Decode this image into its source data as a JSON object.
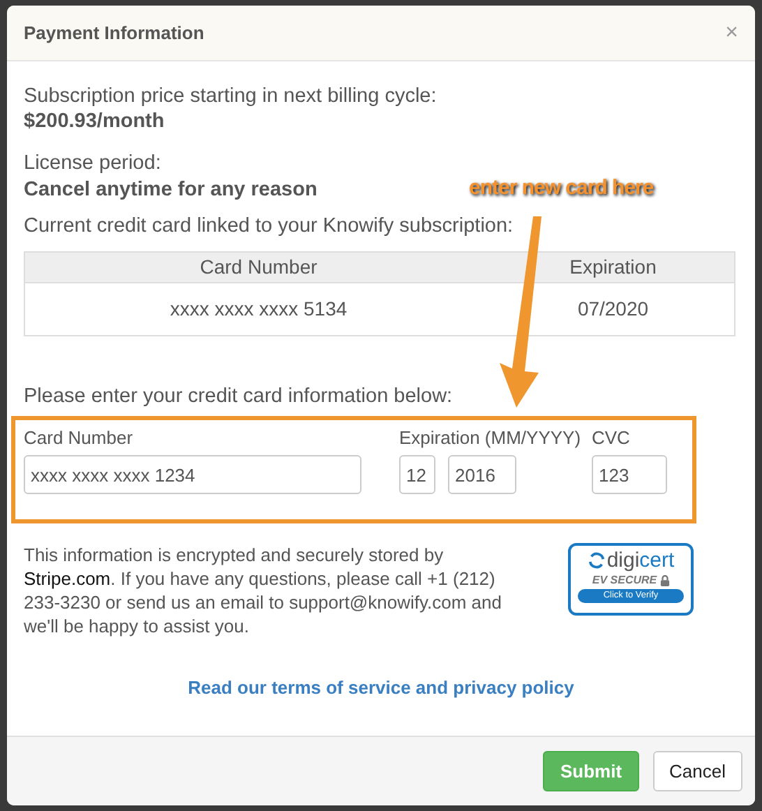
{
  "dialog": {
    "title": "Payment Information",
    "close": "×"
  },
  "subscription": {
    "label": "Subscription price starting in next billing cycle:",
    "price": "$200.93/month"
  },
  "license": {
    "label": "License period:",
    "value": "Cancel anytime for any reason"
  },
  "current_card": {
    "label": "Current credit card linked to your Knowify subscription:",
    "columns": [
      "Card Number",
      "Expiration"
    ],
    "rows": [
      [
        "xxxx xxxx xxxx 5134",
        "07/2020"
      ]
    ]
  },
  "new_card": {
    "label": "Please enter your credit card information below:",
    "fields": [
      {
        "label": "Card Number",
        "inputs": [
          {
            "value": "xxxx xxxx xxxx 1234"
          }
        ]
      },
      {
        "label": "Expiration (MM/YYYY)",
        "inputs": [
          {
            "value": "12"
          },
          {
            "value": "2016"
          }
        ]
      },
      {
        "label": "CVC",
        "inputs": [
          {
            "value": "123"
          }
        ]
      }
    ]
  },
  "info": {
    "before": "This information is encrypted and securely stored by",
    "link": "Stripe.com",
    "after": ". If you have any questions, please call +1 (212) 233-3230 or send us an email to support@knowify.com and we'll be happy to assist you."
  },
  "seal": {
    "brand_a": "digi",
    "brand_b": "cert",
    "line": "EV SECURE",
    "button": "Click to Verify"
  },
  "terms_link": "Read our terms of service and privacy policy",
  "buttons": [
    {
      "label": "Submit",
      "kind": "primary"
    },
    {
      "label": "Cancel",
      "kind": "default"
    }
  ],
  "annotation": {
    "text": "enter new card here"
  }
}
